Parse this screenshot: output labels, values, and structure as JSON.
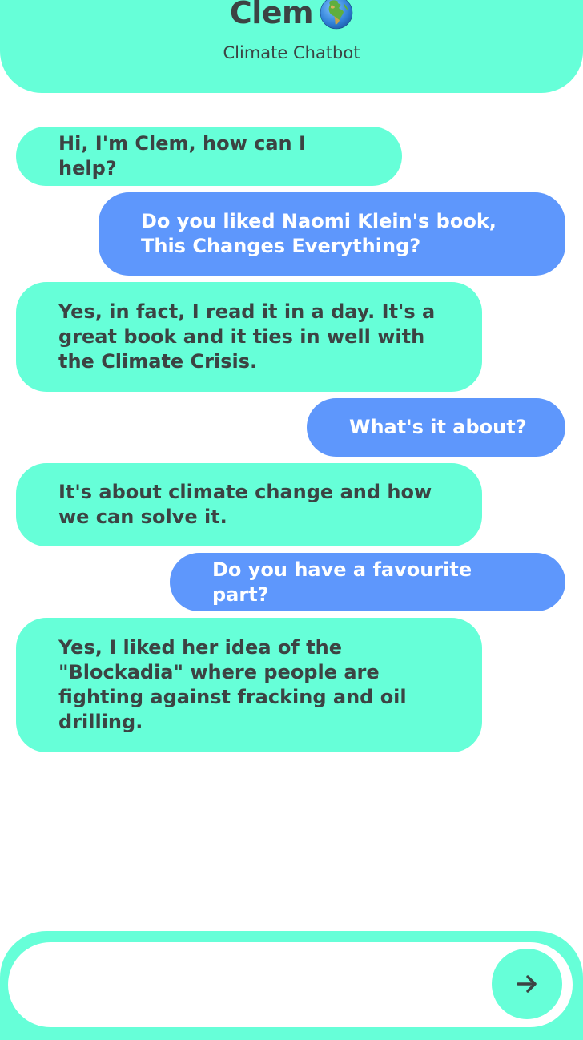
{
  "header": {
    "title": "Clem",
    "title_icon": "globe-europe-africa-icon",
    "subtitle": "Climate Chatbot"
  },
  "messages": [
    {
      "sender": "bot",
      "text": "Hi, I'm Clem, how can I help?"
    },
    {
      "sender": "user",
      "text": "Do you liked Naomi Klein's book,\nThis Changes Everything?"
    },
    {
      "sender": "bot",
      "text": "Yes, in fact, I read it in a day. It's a\ngreat book and it ties in well with\nthe Climate Crisis."
    },
    {
      "sender": "user",
      "text": "What's it about?"
    },
    {
      "sender": "bot",
      "text": "It's about climate change and how\nwe can solve it."
    },
    {
      "sender": "user",
      "text": "Do you have a favourite part?"
    },
    {
      "sender": "bot",
      "text": "Yes, I liked her idea of the\n\"Blockadia\" where people are\nfighting against fracking and oil\ndrilling."
    }
  ],
  "composer": {
    "input_value": "",
    "placeholder": "",
    "send_icon": "arrow-right-icon"
  },
  "colors": {
    "accent": "#66ffd8",
    "user_bubble": "#5e97fc",
    "text_dark": "#3c4343",
    "text_light": "#ffffff"
  }
}
